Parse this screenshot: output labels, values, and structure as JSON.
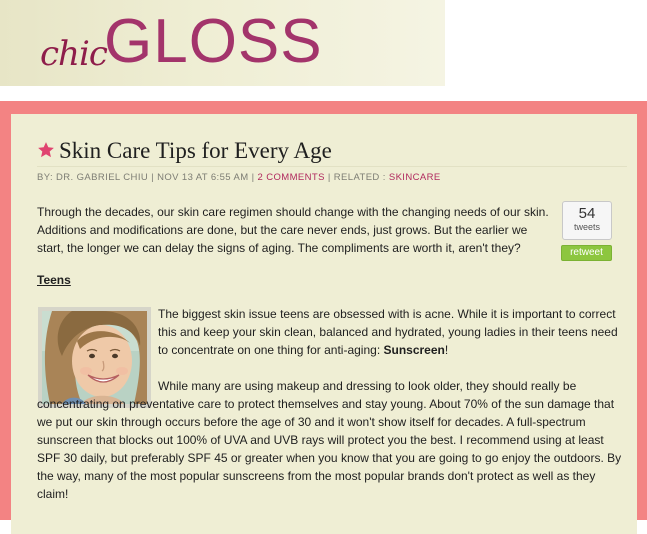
{
  "header": {
    "logo_script": "chic",
    "logo_main": "GLOSS"
  },
  "article": {
    "title": "Skin Care Tips for Every Age",
    "meta": {
      "by": "BY: DR. GABRIEL CHIU | NOV 13 AT 6:55 AM |",
      "comments": "2 COMMENTS",
      "related_label": "| RELATED :",
      "related_link": "SKINCARE"
    },
    "intro": "Through the decades, our skin care regimen should change with the changing needs of our skin. Additions and modifications are done, but the care never ends, just grows. But the earlier we start, the longer we can delay the signs of aging. The compliments are worth it, aren't they?",
    "section_teens": "Teens",
    "teens_p1_a": "The biggest skin issue teens are obsessed with is acne. While it is important to correct this and keep your skin clean, balanced and hydrated, young ladies in their teens need to concentrate on one thing for anti-aging: ",
    "teens_p1_bold": "Sunscreen",
    "teens_p1_end": "!",
    "teens_p2": "While many are using makeup and dressing to look older, they should really be concentrating on preventative care to protect themselves and stay young. About 70% of the sun damage that we put our skin through occurs before the age of 30 and it won't show itself for decades. A full-spectrum sunscreen that blocks out 100% of UVA and UVB rays will protect you the best. I recommend using at least SPF 30 daily, but preferably SPF 45 or greater when you know that you are going to go enjoy the outdoors. By the way, many of the most popular sunscreens from the most popular brands don't protect as well as they claim!"
  },
  "tweet": {
    "count": "54",
    "label": "tweets",
    "button": "retweet"
  },
  "colors": {
    "frame": "#f38383",
    "background": "#efeed4",
    "accent": "#b02a5e"
  },
  "icons": [
    "star-icon"
  ]
}
